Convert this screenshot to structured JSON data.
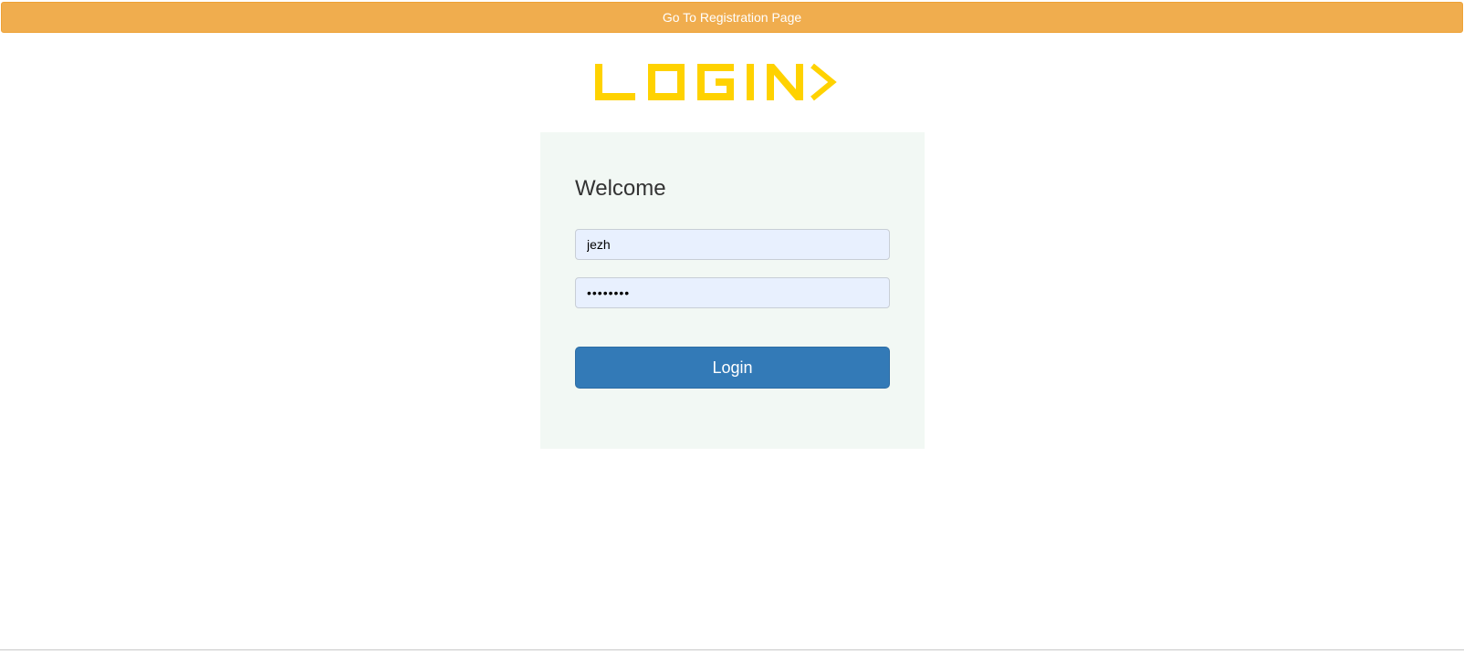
{
  "topbar": {
    "registration_label": "Go To Registration Page",
    "color": "#f0ad4e"
  },
  "logo": {
    "text": "LOGIN",
    "icon": "chevron-right-icon",
    "color": "#ffd200"
  },
  "form": {
    "heading": "Welcome",
    "username_value": "jezh",
    "password_value": "••••••••",
    "login_label": "Login",
    "button_color": "#337ab7",
    "panel_color": "#f2f8f4"
  }
}
